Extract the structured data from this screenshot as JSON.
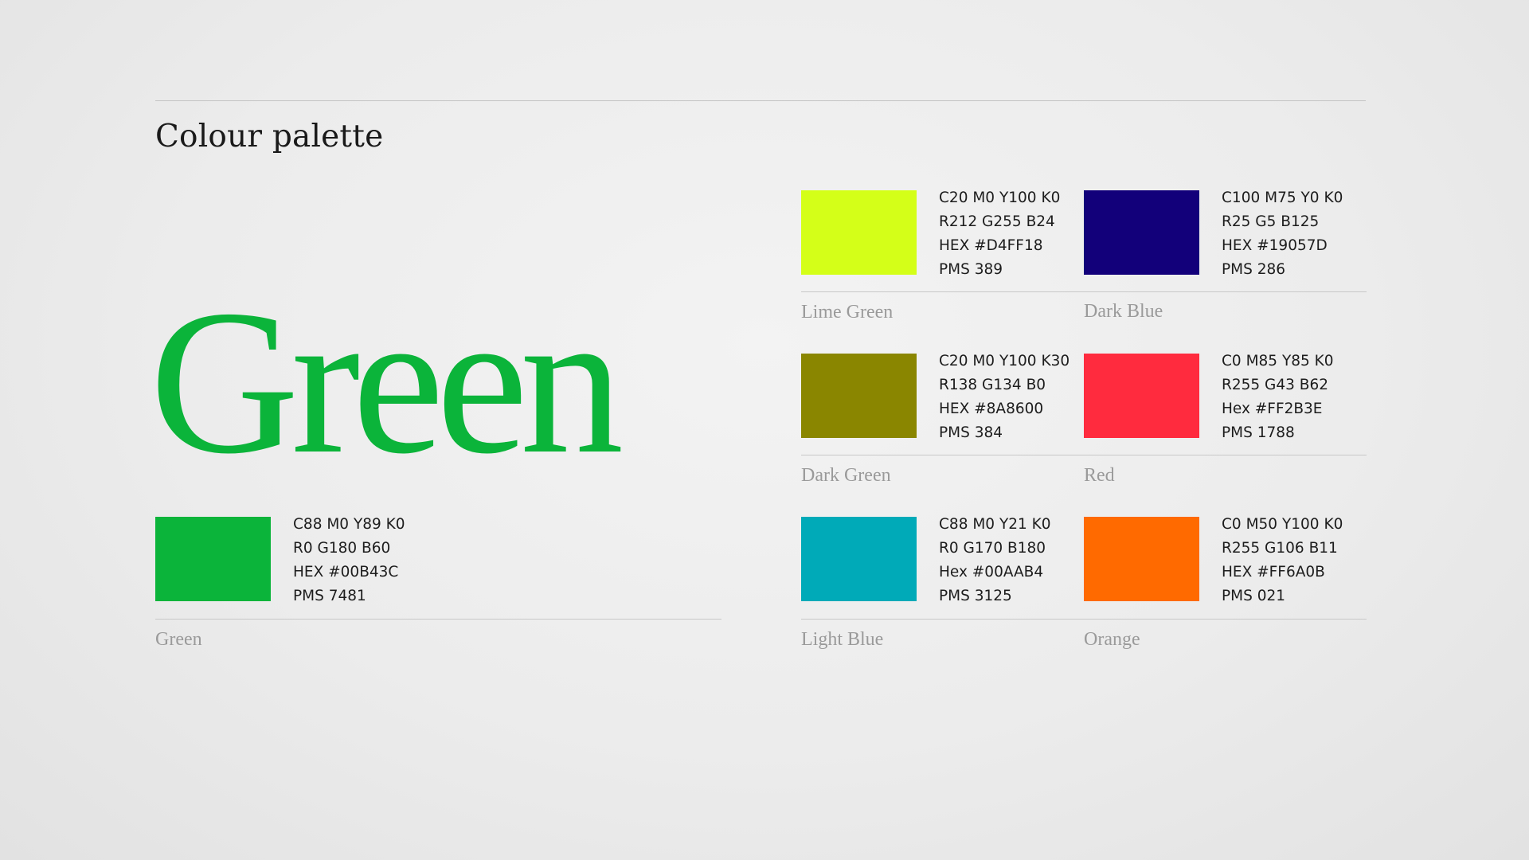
{
  "page": {
    "title": "Colour palette"
  },
  "hero": {
    "word": "Green",
    "color": "#0BB43A"
  },
  "swatches": {
    "green": {
      "name": "Green",
      "color": "#0BB43A",
      "cmyk": "C88 M0 Y89 K0",
      "rgb": "R0 G180 B60",
      "hex": "HEX #00B43C",
      "pms": "PMS 7481"
    },
    "lime_green": {
      "name": "Lime Green",
      "color": "#D4FF18",
      "cmyk": "C20 M0 Y100 K0",
      "rgb": "R212 G255 B24",
      "hex": "HEX #D4FF18",
      "pms": "PMS 389"
    },
    "dark_blue": {
      "name": "Dark Blue",
      "color": "#12007A",
      "cmyk": "C100 M75 Y0 K0",
      "rgb": "R25 G5 B125",
      "hex": "HEX #19057D",
      "pms": "PMS 286"
    },
    "dark_green": {
      "name": "Dark Green",
      "color": "#8A8600",
      "cmyk": "C20 M0 Y100 K30",
      "rgb": "R138 G134 B0",
      "hex": "HEX #8A8600",
      "pms": "PMS 384"
    },
    "red": {
      "name": "Red",
      "color": "#FF2B3E",
      "cmyk": "C0 M85 Y85 K0",
      "rgb": "R255 G43 B62",
      "hex": "Hex #FF2B3E",
      "pms": "PMS 1788"
    },
    "light_blue": {
      "name": "Light Blue",
      "color": "#00AAB8",
      "cmyk": "C88 M0 Y21 K0",
      "rgb": "R0 G170 B180",
      "hex": "Hex #00AAB4",
      "pms": "PMS 3125"
    },
    "orange": {
      "name": "Orange",
      "color": "#FF6A00",
      "cmyk": "C0 M50 Y100 K0",
      "rgb": "R255 G106 B11",
      "hex": "HEX #FF6A0B",
      "pms": "PMS 021"
    }
  }
}
